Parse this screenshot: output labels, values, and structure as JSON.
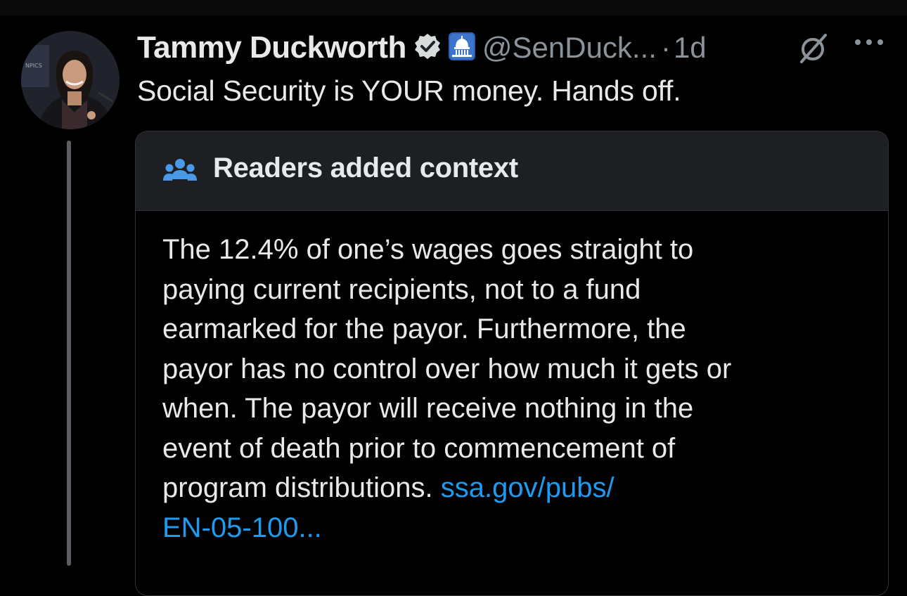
{
  "post": {
    "display_name": "Tammy Duckworth",
    "handle": "@SenDuck...",
    "separator": "·",
    "time": "1d",
    "text": "Social Security is YOUR money. Hands off.",
    "icons": {
      "verified": "verified-badge-icon",
      "affiliation": "us-capitol-icon",
      "grok": "grok-icon",
      "more": "more-options-icon"
    }
  },
  "community_note": {
    "title": "Readers added context",
    "icon": "readers-group-icon",
    "lines": [
      "The 12.4% of one’s wages goes straight to",
      "paying current recipients, not to a fund",
      "earmarked for the payor. Furthermore, the",
      "payor has no control over how much it gets or",
      "when. The payor will receive nothing in the",
      "event of death prior to commencement of"
    ],
    "last_line_text": "program distributions.",
    "link_part1": "ssa.gov/pubs/",
    "link_part2": "EN-05-100..."
  },
  "colors": {
    "background": "#000000",
    "text": "#e7e9ea",
    "secondary_text": "#8b9299",
    "link": "#1d9bf0",
    "note_header_bg": "#1d1f23",
    "border": "#2f3336"
  }
}
